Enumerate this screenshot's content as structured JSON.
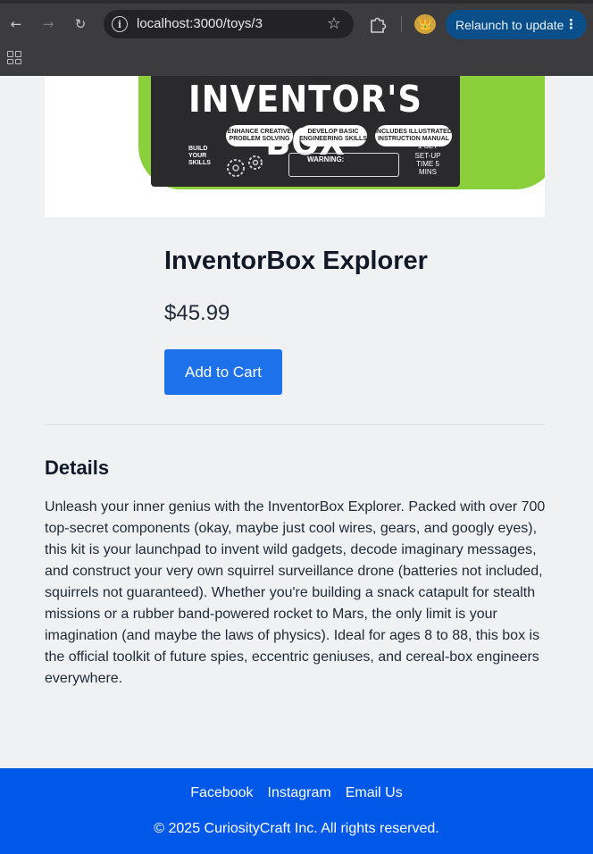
{
  "browser": {
    "url": "localhost:3000/toys/3",
    "relaunch_label": "Relaunch to update",
    "icons": [
      "back-arrow-icon",
      "forward-arrow-icon",
      "reload-icon",
      "site-info-icon",
      "bookmark-star-icon",
      "extensions-puzzle-icon",
      "profile-avatar-icon",
      "more-menu-icon",
      "apps-grid-icon"
    ]
  },
  "product": {
    "image_text": {
      "title": "INVENTOR'S BOX",
      "pill_1": "ENHANCE CREATIVE PROBLEM SOLVING",
      "pill_2": "DEVELOP BASIC ENGINEERING SKILLS",
      "pill_3": "INCLUDES ILLUSTRATED INSTRUCTION MANUAL",
      "side_label": "BUILD YOUR SKILLS",
      "warning": "WARNING:",
      "set_info": "1 SET",
      "setup_time": "SET-UP TIME 5 MINS"
    },
    "name": "InventorBox Explorer",
    "price": "$45.99",
    "add_to_cart_label": "Add to Cart"
  },
  "details": {
    "heading": "Details",
    "description": "Unleash your inner genius with the InventorBox Explorer. Packed with over 700 top-secret components (okay, maybe just cool wires, gears, and googly eyes), this kit is your launchpad to invent wild gadgets, decode imaginary messages, and construct your very own squirrel surveillance drone (batteries not included, squirrels not guaranteed). Whether you're building a snack catapult for stealth missions or a rubber band-powered rocket to Mars, the only limit is your imagination (and maybe the laws of physics). Ideal for ages 8 to 88, this box is the official toolkit of future spies, eccentric geniuses, and cereal-box engineers everywhere."
  },
  "footer": {
    "links": [
      "Facebook",
      "Instagram",
      "Email Us"
    ],
    "copyright": "© 2025 CuriosityCraft Inc. All rights reserved."
  },
  "colors": {
    "primary_button": "#1d72eb",
    "footer_bg": "#0058e8",
    "page_bg": "#f0f1f3",
    "relaunch_bg": "#0b4f8a"
  }
}
